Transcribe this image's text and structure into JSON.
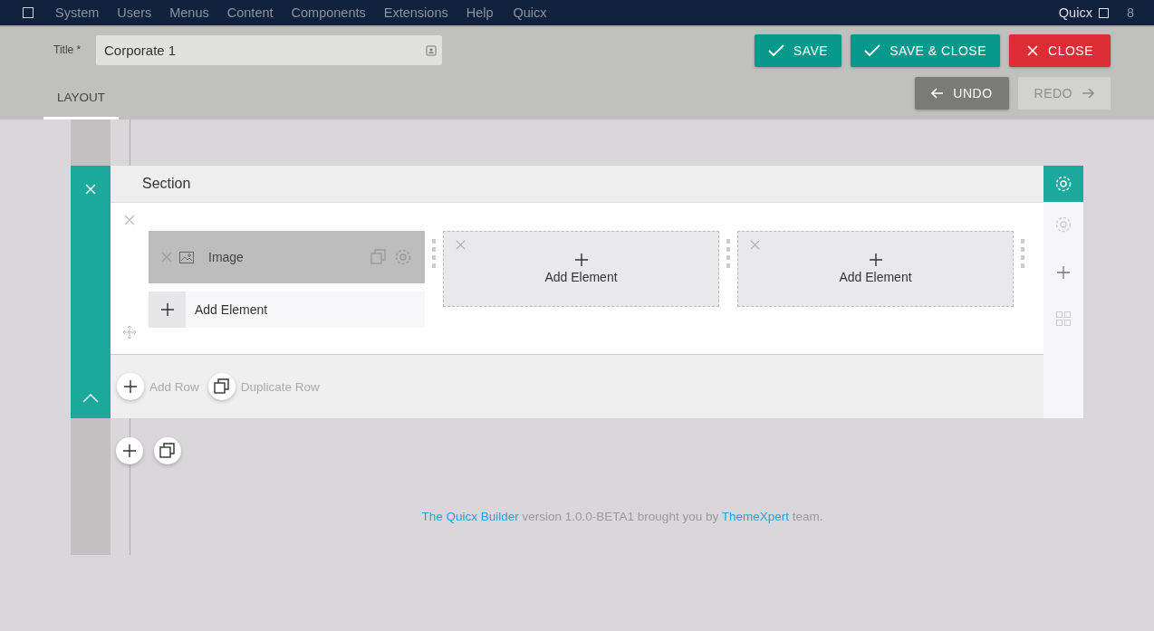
{
  "menu_bar": {
    "items": [
      "System",
      "Users",
      "Menus",
      "Content",
      "Components",
      "Extensions",
      "Help",
      "Quicx"
    ],
    "user": "Quicx",
    "count": "8"
  },
  "title_field": {
    "label": "Title *",
    "value": "Corporate 1"
  },
  "tabs": [
    {
      "label": "LAYOUT",
      "selected": true
    }
  ],
  "actions": [
    {
      "label": "SAVE",
      "kind": "save",
      "disabled": false
    },
    {
      "label": "SAVE & CLOSE",
      "kind": "save",
      "disabled": false
    },
    {
      "label": "CLOSE",
      "kind": "close",
      "disabled": false
    }
  ],
  "history": [
    {
      "label": "UNDO",
      "kind": "undo",
      "disabled": false
    },
    {
      "label": "REDO",
      "kind": "redo",
      "disabled": true
    }
  ],
  "section": {
    "title": "Section",
    "columns": [
      {
        "elements": [
          {
            "name": "Image",
            "kind": "image"
          }
        ],
        "add_label": "Add Element"
      },
      {
        "add_label": "Add Element"
      },
      {
        "add_label": "Add Element"
      }
    ],
    "add_row": "Add Row",
    "duplicate_row": "Duplicate Row"
  },
  "footer": [
    {
      "kind": "link",
      "text": "The Quicx Builder"
    },
    {
      "kind": "text",
      "text": " version 1.0.0-BETA1 brought you by "
    },
    {
      "kind": "link",
      "text": "ThemeXpert"
    },
    {
      "kind": "text",
      "text": " team."
    }
  ]
}
